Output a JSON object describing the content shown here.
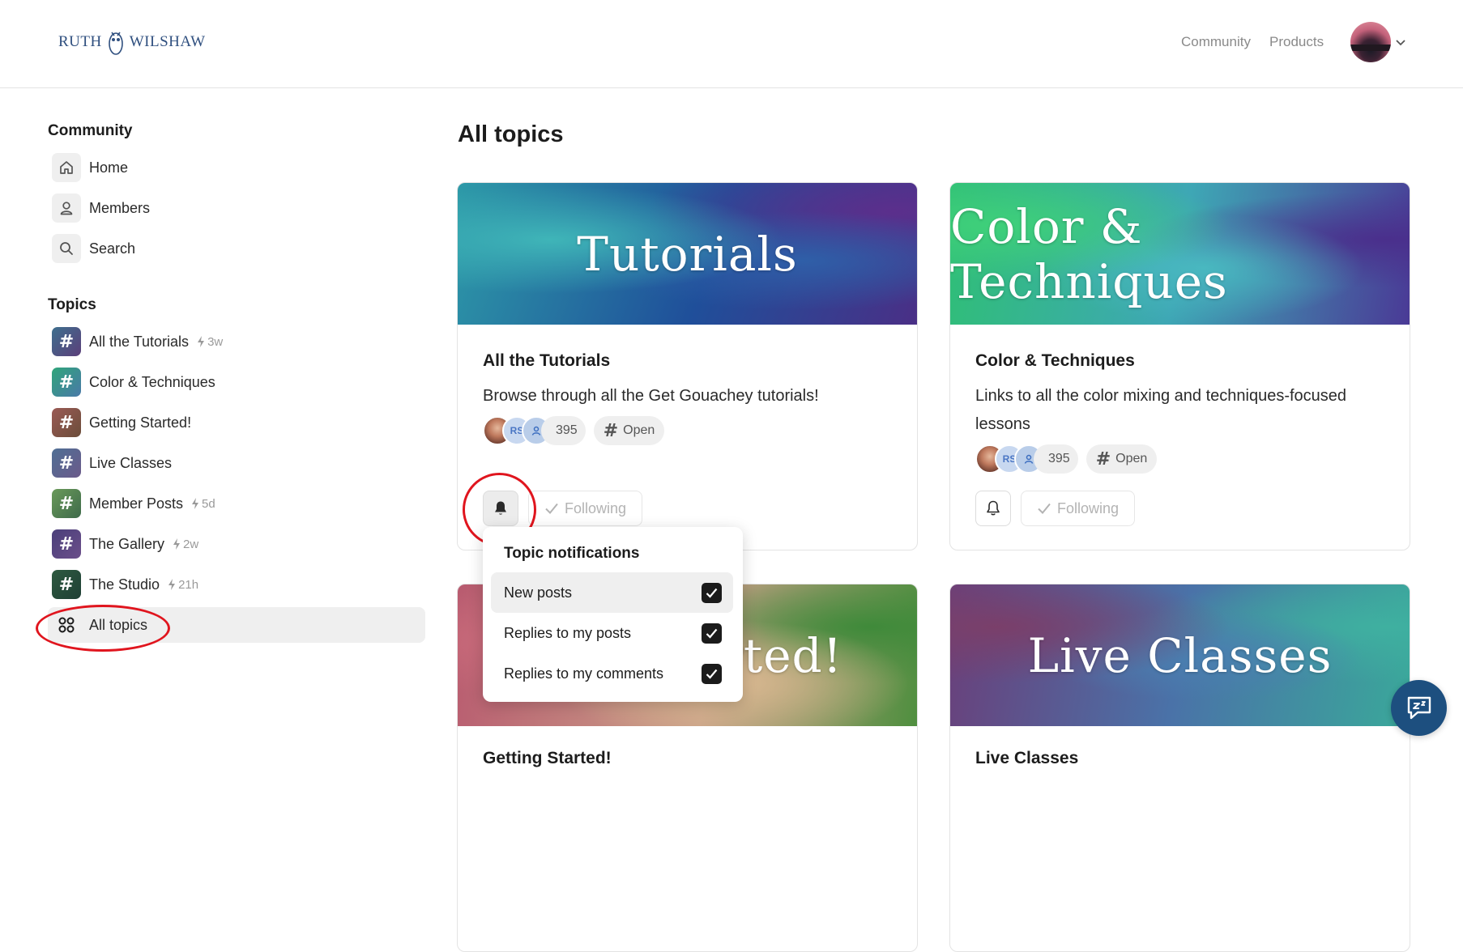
{
  "header": {
    "logo_text": "RUTH WILSHAW",
    "nav": [
      {
        "label": "Community"
      },
      {
        "label": "Products"
      }
    ]
  },
  "sidebar": {
    "community_title": "Community",
    "community_items": [
      {
        "label": "Home",
        "icon": "home-icon"
      },
      {
        "label": "Members",
        "icon": "user-icon"
      },
      {
        "label": "Search",
        "icon": "search-icon"
      }
    ],
    "topics_title": "Topics",
    "topics": [
      {
        "label": "All the Tutorials",
        "activity": "3w",
        "color": "#46607e"
      },
      {
        "label": "Color & Techniques",
        "activity": "",
        "color": "#3f8f84"
      },
      {
        "label": "Getting Started!",
        "activity": "",
        "color": "#8c5a58"
      },
      {
        "label": "Live Classes",
        "activity": "",
        "color": "#556a8c"
      },
      {
        "label": "Member Posts",
        "activity": "5d",
        "color": "#5f8a56"
      },
      {
        "label": "The Gallery",
        "activity": "2w",
        "color": "#574a7a"
      },
      {
        "label": "The Studio",
        "activity": "21h",
        "color": "#2e5a40"
      }
    ],
    "all_topics": {
      "label": "All topics",
      "icon": "grid-icon"
    }
  },
  "main": {
    "title": "All topics",
    "cards": [
      {
        "banner": "Tutorials",
        "title": "All the Tutorials",
        "desc": "Browse through all the Get Gouachey tutorials!",
        "member_count": "395",
        "access": "Open",
        "following": "Following",
        "avatar_initials": "RS"
      },
      {
        "banner": "Color & Techniques",
        "title": "Color & Techniques",
        "desc": "Links to all the color mixing and techniques-focused lessons",
        "member_count": "395",
        "access": "Open",
        "following": "Following",
        "avatar_initials": "RS"
      },
      {
        "banner": "arted!",
        "title": "Getting Started!"
      },
      {
        "banner": "Live Classes",
        "title": "Live Classes"
      }
    ]
  },
  "dropdown": {
    "title": "Topic notifications",
    "items": [
      {
        "label": "New posts",
        "checked": true
      },
      {
        "label": "Replies to my posts",
        "checked": true
      },
      {
        "label": "Replies to my comments",
        "checked": true
      }
    ]
  },
  "colors": {
    "accent_ring": "#e0151e",
    "help_button": "#1d4f7f"
  }
}
